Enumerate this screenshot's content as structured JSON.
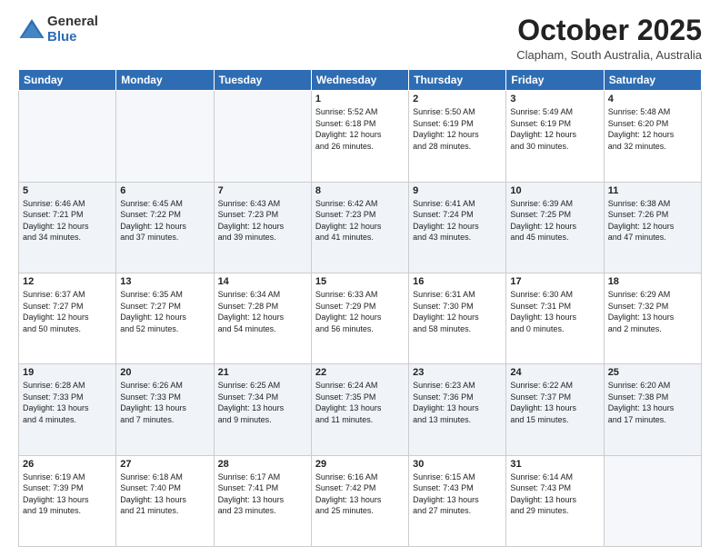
{
  "logo": {
    "general": "General",
    "blue": "Blue"
  },
  "title": "October 2025",
  "location": "Clapham, South Australia, Australia",
  "weekdays": [
    "Sunday",
    "Monday",
    "Tuesday",
    "Wednesday",
    "Thursday",
    "Friday",
    "Saturday"
  ],
  "weeks": [
    [
      {
        "day": "",
        "info": ""
      },
      {
        "day": "",
        "info": ""
      },
      {
        "day": "",
        "info": ""
      },
      {
        "day": "1",
        "info": "Sunrise: 5:52 AM\nSunset: 6:18 PM\nDaylight: 12 hours\nand 26 minutes."
      },
      {
        "day": "2",
        "info": "Sunrise: 5:50 AM\nSunset: 6:19 PM\nDaylight: 12 hours\nand 28 minutes."
      },
      {
        "day": "3",
        "info": "Sunrise: 5:49 AM\nSunset: 6:19 PM\nDaylight: 12 hours\nand 30 minutes."
      },
      {
        "day": "4",
        "info": "Sunrise: 5:48 AM\nSunset: 6:20 PM\nDaylight: 12 hours\nand 32 minutes."
      }
    ],
    [
      {
        "day": "5",
        "info": "Sunrise: 6:46 AM\nSunset: 7:21 PM\nDaylight: 12 hours\nand 34 minutes."
      },
      {
        "day": "6",
        "info": "Sunrise: 6:45 AM\nSunset: 7:22 PM\nDaylight: 12 hours\nand 37 minutes."
      },
      {
        "day": "7",
        "info": "Sunrise: 6:43 AM\nSunset: 7:23 PM\nDaylight: 12 hours\nand 39 minutes."
      },
      {
        "day": "8",
        "info": "Sunrise: 6:42 AM\nSunset: 7:23 PM\nDaylight: 12 hours\nand 41 minutes."
      },
      {
        "day": "9",
        "info": "Sunrise: 6:41 AM\nSunset: 7:24 PM\nDaylight: 12 hours\nand 43 minutes."
      },
      {
        "day": "10",
        "info": "Sunrise: 6:39 AM\nSunset: 7:25 PM\nDaylight: 12 hours\nand 45 minutes."
      },
      {
        "day": "11",
        "info": "Sunrise: 6:38 AM\nSunset: 7:26 PM\nDaylight: 12 hours\nand 47 minutes."
      }
    ],
    [
      {
        "day": "12",
        "info": "Sunrise: 6:37 AM\nSunset: 7:27 PM\nDaylight: 12 hours\nand 50 minutes."
      },
      {
        "day": "13",
        "info": "Sunrise: 6:35 AM\nSunset: 7:27 PM\nDaylight: 12 hours\nand 52 minutes."
      },
      {
        "day": "14",
        "info": "Sunrise: 6:34 AM\nSunset: 7:28 PM\nDaylight: 12 hours\nand 54 minutes."
      },
      {
        "day": "15",
        "info": "Sunrise: 6:33 AM\nSunset: 7:29 PM\nDaylight: 12 hours\nand 56 minutes."
      },
      {
        "day": "16",
        "info": "Sunrise: 6:31 AM\nSunset: 7:30 PM\nDaylight: 12 hours\nand 58 minutes."
      },
      {
        "day": "17",
        "info": "Sunrise: 6:30 AM\nSunset: 7:31 PM\nDaylight: 13 hours\nand 0 minutes."
      },
      {
        "day": "18",
        "info": "Sunrise: 6:29 AM\nSunset: 7:32 PM\nDaylight: 13 hours\nand 2 minutes."
      }
    ],
    [
      {
        "day": "19",
        "info": "Sunrise: 6:28 AM\nSunset: 7:33 PM\nDaylight: 13 hours\nand 4 minutes."
      },
      {
        "day": "20",
        "info": "Sunrise: 6:26 AM\nSunset: 7:33 PM\nDaylight: 13 hours\nand 7 minutes."
      },
      {
        "day": "21",
        "info": "Sunrise: 6:25 AM\nSunset: 7:34 PM\nDaylight: 13 hours\nand 9 minutes."
      },
      {
        "day": "22",
        "info": "Sunrise: 6:24 AM\nSunset: 7:35 PM\nDaylight: 13 hours\nand 11 minutes."
      },
      {
        "day": "23",
        "info": "Sunrise: 6:23 AM\nSunset: 7:36 PM\nDaylight: 13 hours\nand 13 minutes."
      },
      {
        "day": "24",
        "info": "Sunrise: 6:22 AM\nSunset: 7:37 PM\nDaylight: 13 hours\nand 15 minutes."
      },
      {
        "day": "25",
        "info": "Sunrise: 6:20 AM\nSunset: 7:38 PM\nDaylight: 13 hours\nand 17 minutes."
      }
    ],
    [
      {
        "day": "26",
        "info": "Sunrise: 6:19 AM\nSunset: 7:39 PM\nDaylight: 13 hours\nand 19 minutes."
      },
      {
        "day": "27",
        "info": "Sunrise: 6:18 AM\nSunset: 7:40 PM\nDaylight: 13 hours\nand 21 minutes."
      },
      {
        "day": "28",
        "info": "Sunrise: 6:17 AM\nSunset: 7:41 PM\nDaylight: 13 hours\nand 23 minutes."
      },
      {
        "day": "29",
        "info": "Sunrise: 6:16 AM\nSunset: 7:42 PM\nDaylight: 13 hours\nand 25 minutes."
      },
      {
        "day": "30",
        "info": "Sunrise: 6:15 AM\nSunset: 7:43 PM\nDaylight: 13 hours\nand 27 minutes."
      },
      {
        "day": "31",
        "info": "Sunrise: 6:14 AM\nSunset: 7:43 PM\nDaylight: 13 hours\nand 29 minutes."
      },
      {
        "day": "",
        "info": ""
      }
    ]
  ]
}
